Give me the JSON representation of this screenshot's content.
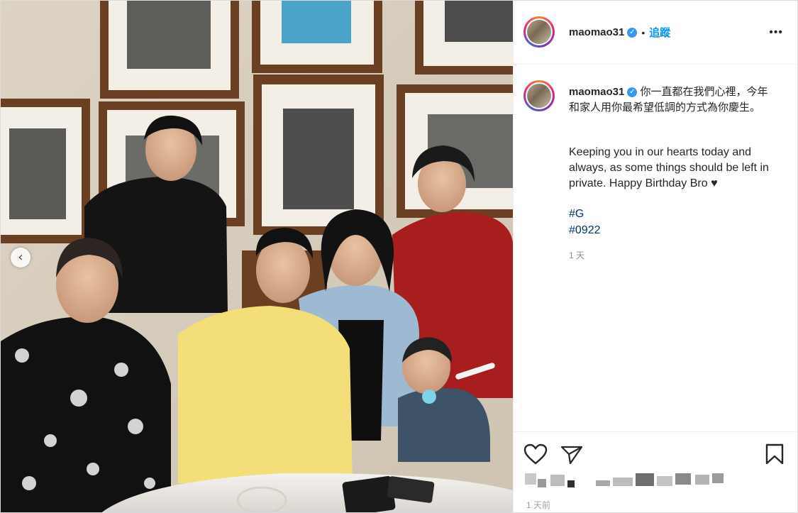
{
  "header": {
    "username": "maomao31",
    "verified_icon": "verified-badge-icon",
    "separator": "•",
    "follow_label": "追蹤",
    "more_label": "•••"
  },
  "caption": {
    "username": "maomao31",
    "text_zh": "你一直都在我們心裡，今年和家人用你最希望低調的方式為你慶生。",
    "text_en": "Keeping you in our hearts today and always, as some things should be left in private. Happy Birthday Bro ♥",
    "hashtags": [
      "#G",
      "#0922"
    ],
    "time": "1 天"
  },
  "footer": {
    "time": "1 天前",
    "icons": [
      "heart-icon",
      "share-icon",
      "bookmark-icon"
    ]
  },
  "colors": {
    "accent": "#0095f6",
    "link": "#00376b",
    "text": "#262626",
    "muted": "#8e8e8e"
  }
}
